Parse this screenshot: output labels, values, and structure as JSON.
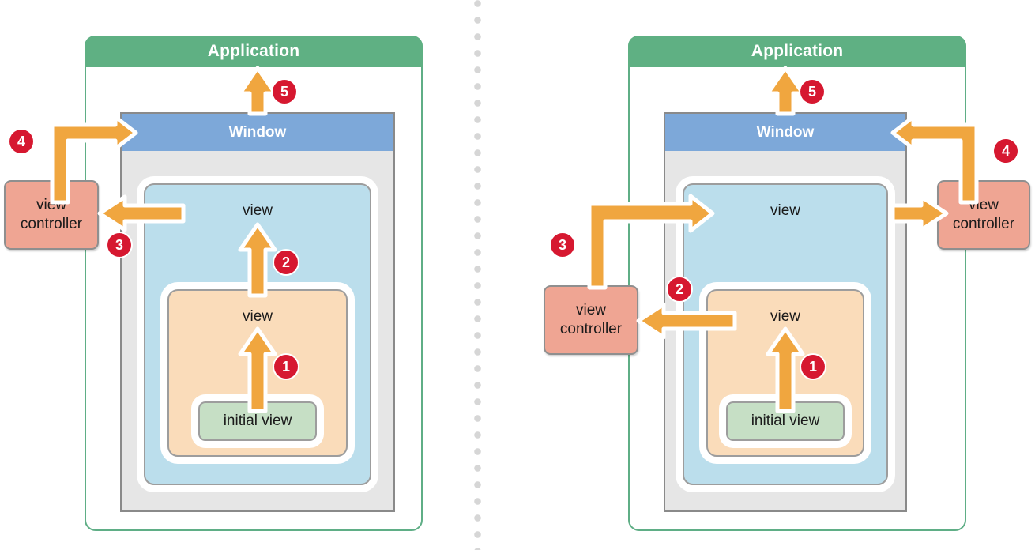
{
  "diagram": {
    "title_left": "Application",
    "title_right": "Application",
    "divider": "vertical-dotted-divider",
    "accent_colors": {
      "application_green": "#5fb083",
      "window_blue": "#7da8d9",
      "view_blue": "#bbdeec",
      "view_peach": "#fadcba",
      "initial_view_green": "#c6dfc5",
      "view_controller_salmon": "#efa593",
      "arrow_orange": "#f0a63f",
      "badge_red": "#d61830",
      "window_chrome_gray": "#e6e6e6"
    }
  },
  "panels": [
    {
      "id": "left",
      "application_label": "Application",
      "window_label": "Window",
      "outer_view_label": "view",
      "inner_view_label": "view",
      "initial_view_label": "initial view",
      "view_controllers": [
        {
          "line1": "view",
          "line2": "controller"
        }
      ],
      "steps": [
        {
          "number": "1",
          "from": "initial view",
          "to": "view (inner)"
        },
        {
          "number": "2",
          "from": "view (inner)",
          "to": "view (outer)"
        },
        {
          "number": "3",
          "from": "view (outer)",
          "to": "view controller"
        },
        {
          "number": "4",
          "from": "view controller",
          "to": "Window"
        },
        {
          "number": "5",
          "from": "Window",
          "to": "Application"
        }
      ]
    },
    {
      "id": "right",
      "application_label": "Application",
      "window_label": "Window",
      "outer_view_label": "view",
      "inner_view_label": "view",
      "initial_view_label": "initial view",
      "view_controllers": [
        {
          "line1": "view",
          "line2": "controller"
        },
        {
          "line1": "view",
          "line2": "controller"
        }
      ],
      "steps": [
        {
          "number": "1",
          "from": "initial view",
          "to": "view (inner)"
        },
        {
          "number": "2",
          "from": "view (inner)",
          "to": "view controller (lower)"
        },
        {
          "number": "3",
          "from": "view controller (lower)",
          "to": "view (outer)"
        },
        {
          "number": "4",
          "from": "view controller (upper)",
          "to": "Window"
        },
        {
          "number": "5",
          "from": "Window",
          "to": "Application"
        }
      ]
    }
  ]
}
